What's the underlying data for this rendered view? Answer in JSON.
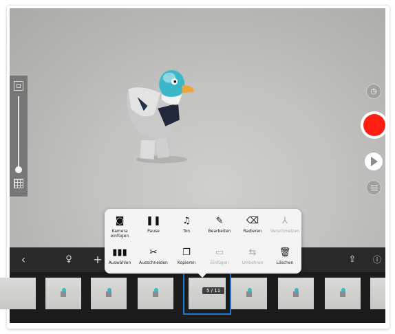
{
  "camera_controls": {
    "timer_icon": "timer-icon",
    "record_color": "#ff2013",
    "play_icon": "play-icon",
    "menu_icon": "menu-icon"
  },
  "toolbar": {
    "back_icon": "chevron-left-icon",
    "mic_icon": "microphone-icon",
    "add_icon": "plus-icon",
    "share_icon": "share-icon",
    "help_icon": "help-icon"
  },
  "filmstrip": {
    "counter": "5 / 11",
    "selected_index": 5,
    "total": 11
  },
  "popover": {
    "row1": [
      {
        "label": "Kamera einfügen",
        "icon": "camera-icon",
        "enabled": true
      },
      {
        "label": "Pause",
        "icon": "pause-icon",
        "enabled": true
      },
      {
        "label": "Ton",
        "icon": "music-note-icon",
        "enabled": true
      },
      {
        "label": "Bearbeiten",
        "icon": "brush-icon",
        "enabled": true
      },
      {
        "label": "Radieren",
        "icon": "eraser-icon",
        "enabled": true
      },
      {
        "label": "Verschmelzen",
        "icon": "merge-icon",
        "enabled": false
      }
    ],
    "row2": [
      {
        "label": "Auswählen",
        "icon": "select-frames-icon",
        "enabled": true
      },
      {
        "label": "Ausschneiden",
        "icon": "scissors-icon",
        "enabled": true
      },
      {
        "label": "Kopieren",
        "icon": "copy-icon",
        "enabled": true
      },
      {
        "label": "Einfügen",
        "icon": "paste-icon",
        "enabled": false
      },
      {
        "label": "Umkehren",
        "icon": "reverse-icon",
        "enabled": false
      },
      {
        "label": "Löschen",
        "icon": "trash-icon",
        "enabled": true
      }
    ]
  }
}
